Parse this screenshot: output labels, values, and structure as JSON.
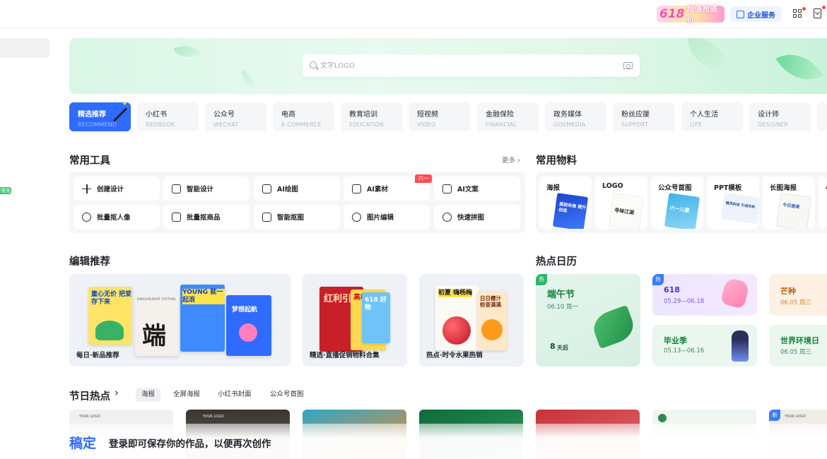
{
  "header": {
    "promo_number": "618",
    "promo_text": "超值抢底价",
    "enterprise_label": "企业服务"
  },
  "sidebar": {
    "badge": "限免"
  },
  "search": {
    "placeholder": "文字LOGO"
  },
  "categories": [
    {
      "zh": "精选推荐",
      "en": "RECOMMEND"
    },
    {
      "zh": "小红书",
      "en": "REDBOOK"
    },
    {
      "zh": "公众号",
      "en": "WECHAT"
    },
    {
      "zh": "电商",
      "en": "E-COMMERCE"
    },
    {
      "zh": "教育培训",
      "en": "EDUCATION"
    },
    {
      "zh": "短视频",
      "en": "VIDEO"
    },
    {
      "zh": "金融保险",
      "en": "FINANCIAL"
    },
    {
      "zh": "政务媒体",
      "en": "GOVMEDIA"
    },
    {
      "zh": "粉丝应援",
      "en": "SUPPORT"
    },
    {
      "zh": "个人生活",
      "en": "LIFE"
    },
    {
      "zh": "设计师",
      "en": "DESIGNER"
    }
  ],
  "tools": {
    "title": "常用工具",
    "more": "更多 ›",
    "badge": "六一",
    "items": [
      "创建设计",
      "智能设计",
      "AI绘图",
      "AI素材",
      "AI文案",
      "批量抠人像",
      "批量抠商品",
      "智能抠图",
      "图片编辑",
      "快速拼图"
    ]
  },
  "materials": {
    "title": "常用物料",
    "items": [
      "海报",
      "LOGO",
      "公众号首图",
      "PPT模板",
      "长图海报",
      "小"
    ],
    "thumb_texts": [
      "超前布局 提升创造",
      "寻味江湖",
      "六一儿童",
      "精灵科技 引领未来",
      "今日速递"
    ]
  },
  "recommend": {
    "title": "编辑推荐",
    "cards": [
      {
        "label": "每日·新品推荐",
        "posters": [
          "童心无价 把爱存下来",
          "DRAGON BOAT FESTIVAL",
          "YOUNG 就一起浪",
          "梦想起航"
        ],
        "glyph": "端"
      },
      {
        "label": "精选·直播促销物料合集",
        "posters": [
          "红利引爆",
          "高校直播",
          "618 好物"
        ]
      },
      {
        "label": "热点·时令水果热销",
        "posters": [
          "初夏 嗨杨梅",
          "日日樱汁 检查满满"
        ]
      }
    ]
  },
  "calendar": {
    "title": "热点日历",
    "hot_badge": "热",
    "events": [
      {
        "name": "端午节",
        "date": "06.10 周一",
        "countdown_num": "8",
        "countdown_unit": "天后"
      },
      {
        "name": "618",
        "date": "05.29—06.18"
      },
      {
        "name": "芒种",
        "date": "06.05 周三"
      },
      {
        "name": "毕业季",
        "date": "05.13—06.16"
      },
      {
        "name": "世界环境日",
        "date": "06.05 周三"
      }
    ]
  },
  "holidays": {
    "title": "节日热点",
    "arrow": "›",
    "tabs": [
      "海报",
      "全屏海报",
      "小红书封面",
      "公众号首图"
    ],
    "tpl_texts": [
      "YOUR LOGO",
      "YOUR LOGO",
      "YOUR LOGO"
    ],
    "new_badge": "新"
  },
  "login": {
    "brand": "稿定",
    "message": "登录即可保存你的作品，以便再次创作"
  },
  "colors": {
    "accent": "#2f6bff",
    "banner": "#dff7e8"
  }
}
